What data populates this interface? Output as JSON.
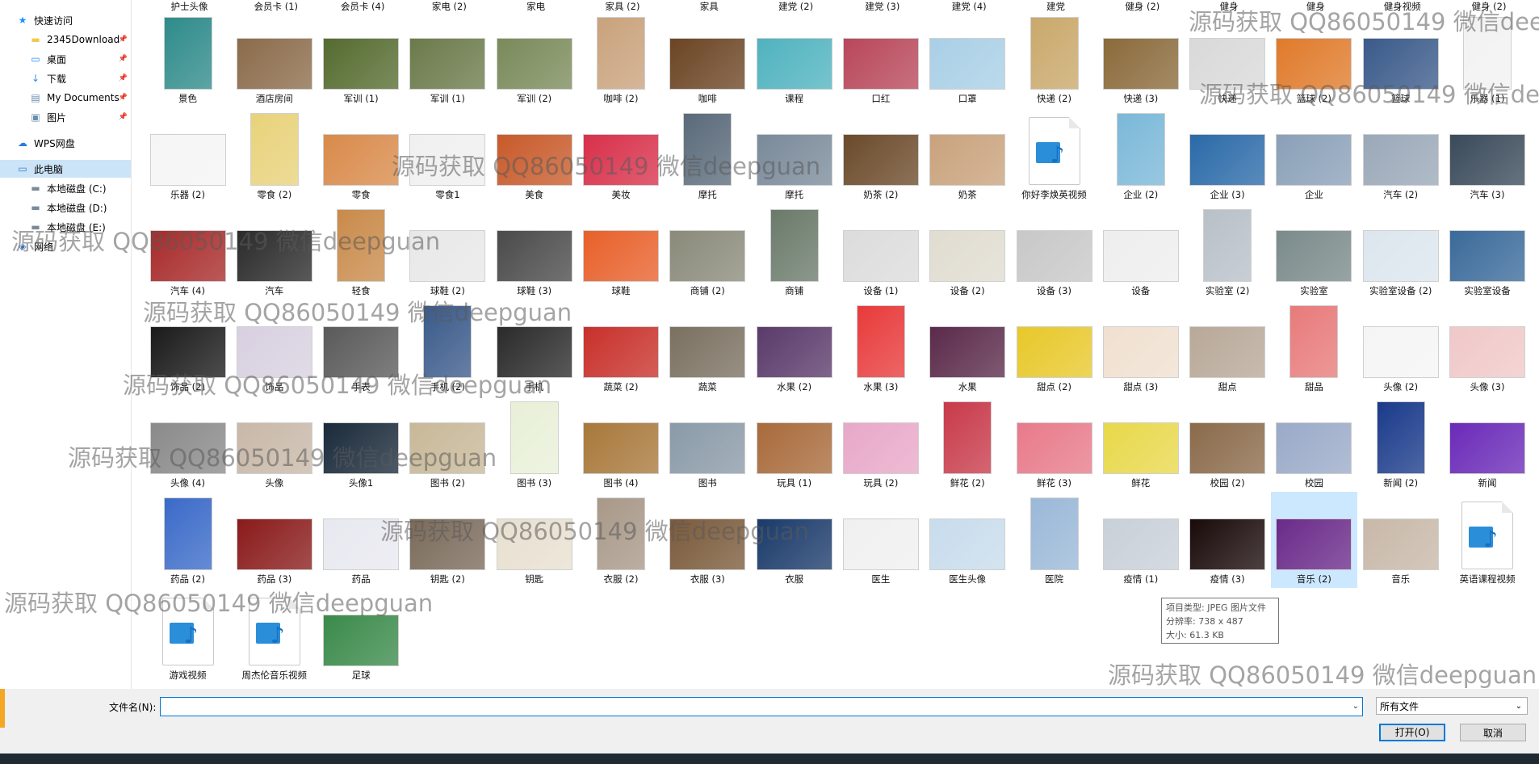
{
  "nav": [
    {
      "label": "快速访问",
      "icon": "star-icon",
      "pinned": false,
      "selected": false
    },
    {
      "label": "2345Download",
      "icon": "folder-icon",
      "pinned": true,
      "selected": false
    },
    {
      "label": "桌面",
      "icon": "desktop-icon",
      "pinned": true,
      "selected": false
    },
    {
      "label": "下载",
      "icon": "download-icon",
      "pinned": true,
      "selected": false
    },
    {
      "label": "My Documents",
      "icon": "documents-icon",
      "pinned": true,
      "selected": false
    },
    {
      "label": "图片",
      "icon": "pictures-icon",
      "pinned": true,
      "selected": false
    },
    {
      "label": "WPS网盘",
      "icon": "cloud-icon",
      "pinned": false,
      "selected": false
    },
    {
      "label": "此电脑",
      "icon": "computer-icon",
      "pinned": false,
      "selected": true
    },
    {
      "label": "本地磁盘 (C:)",
      "icon": "drive-icon",
      "pinned": false,
      "selected": false
    },
    {
      "label": "本地磁盘 (D:)",
      "icon": "drive-icon",
      "pinned": false,
      "selected": false
    },
    {
      "label": "本地磁盘 (E:)",
      "icon": "drive-icon",
      "pinned": false,
      "selected": false
    },
    {
      "label": "网络",
      "icon": "network-icon",
      "pinned": false,
      "selected": false
    }
  ],
  "top_row": [
    "护士头像",
    "会员卡 (1)",
    "会员卡 (4)",
    "家电 (2)",
    "家电",
    "家具 (2)",
    "家具",
    "建党 (2)",
    "建党 (3)",
    "建党 (4)",
    "建党",
    "健身 (2)",
    "健身",
    "健身",
    "健身视频",
    "健身 (2)"
  ],
  "rows": [
    [
      {
        "label": "景色",
        "color": "#2e8b8a"
      },
      {
        "label": "酒店房间",
        "color": "#8b6b4a"
      },
      {
        "label": "军训 (1)",
        "color": "#556b2f"
      },
      {
        "label": "军训 (1)",
        "color": "#6b7a4a"
      },
      {
        "label": "军训 (2)",
        "color": "#7a8a5a"
      },
      {
        "label": "咖啡 (2)",
        "color": "#c9a27c"
      },
      {
        "label": "咖啡",
        "color": "#6b4423"
      },
      {
        "label": "课程",
        "color": "#4fb3bf"
      },
      {
        "label": "口红",
        "color": "#b8475a"
      },
      {
        "label": "口罩",
        "color": "#a9cfe6"
      },
      {
        "label": "快递 (2)",
        "color": "#c9a86a"
      },
      {
        "label": "快递 (3)",
        "color": "#8a6a3a"
      },
      {
        "label": "快递",
        "color": "#d9d9d9"
      },
      {
        "label": "篮球 (2)",
        "color": "#e07a2a"
      },
      {
        "label": "篮球",
        "color": "#3a5a8a"
      },
      {
        "label": "乐器 (1)",
        "color": "#f2f2f2"
      }
    ],
    [
      {
        "label": "乐器 (2)",
        "color": "#f5f5f5"
      },
      {
        "label": "零食 (2)",
        "color": "#e8d27a"
      },
      {
        "label": "零食",
        "color": "#d98a4a"
      },
      {
        "label": "零食1",
        "color": "#f0f0f0"
      },
      {
        "label": "美食",
        "color": "#c85a2a"
      },
      {
        "label": "美妆",
        "color": "#d8304a"
      },
      {
        "label": "摩托",
        "color": "#5a6a7a"
      },
      {
        "label": "摩托",
        "color": "#7a8a9a"
      },
      {
        "label": "奶茶 (2)",
        "color": "#6b4a2a"
      },
      {
        "label": "奶茶",
        "color": "#c9a27c"
      },
      {
        "label": "你好李焕英视频",
        "color": "video"
      },
      {
        "label": "企业 (2)",
        "color": "#7ab8d8"
      },
      {
        "label": "企业 (3)",
        "color": "#2a6aa8"
      },
      {
        "label": "企业",
        "color": "#8aa0b8"
      },
      {
        "label": "汽车 (2)",
        "color": "#9aa8b8"
      },
      {
        "label": "汽车 (3)",
        "color": "#3a4a5a"
      }
    ],
    [
      {
        "label": "汽车 (4)",
        "color": "#a82a2a"
      },
      {
        "label": "汽车",
        "color": "#2a2a2a"
      },
      {
        "label": "轻食",
        "color": "#c98a4a"
      },
      {
        "label": "球鞋 (2)",
        "color": "#e8e8e8"
      },
      {
        "label": "球鞋 (3)",
        "color": "#4a4a4a"
      },
      {
        "label": "球鞋",
        "color": "#e8602a"
      },
      {
        "label": "商铺 (2)",
        "color": "#8a8a7a"
      },
      {
        "label": "商铺",
        "color": "#6a7a6a"
      },
      {
        "label": "设备 (1)",
        "color": "#dcdcdc"
      },
      {
        "label": "设备 (2)",
        "color": "#e0dcd0"
      },
      {
        "label": "设备 (3)",
        "color": "#c8c8c8"
      },
      {
        "label": "设备",
        "color": "#eeeeee"
      },
      {
        "label": "实验室 (2)",
        "color": "#b8c0c8"
      },
      {
        "label": "实验室",
        "color": "#7a8a8a"
      },
      {
        "label": "实验室设备 (2)",
        "color": "#dce6ee"
      },
      {
        "label": "实验室设备",
        "color": "#3a6a9a"
      }
    ],
    [
      {
        "label": "饰品 (2)",
        "color": "#1a1a1a"
      },
      {
        "label": "饰品",
        "color": "#d8d0e0"
      },
      {
        "label": "手表",
        "color": "#5a5a5a"
      },
      {
        "label": "手机 (2)",
        "color": "#3a5a8a"
      },
      {
        "label": "手机",
        "color": "#2a2a2a"
      },
      {
        "label": "蔬菜 (2)",
        "color": "#c8302a"
      },
      {
        "label": "蔬菜",
        "color": "#7a7060"
      },
      {
        "label": "水果 (2)",
        "color": "#5a3a6a"
      },
      {
        "label": "水果 (3)",
        "color": "#e83a3a"
      },
      {
        "label": "水果",
        "color": "#5a2a4a"
      },
      {
        "label": "甜点 (2)",
        "color": "#e8c82a"
      },
      {
        "label": "甜点 (3)",
        "color": "#f0e0d0"
      },
      {
        "label": "甜点",
        "color": "#b8a898"
      },
      {
        "label": "甜品",
        "color": "#e87a7a"
      },
      {
        "label": "头像 (2)",
        "color": "#f5f5f5"
      },
      {
        "label": "头像 (3)",
        "color": "#f0c8c8"
      }
    ],
    [
      {
        "label": "头像 (4)",
        "color": "#8a8a8a"
      },
      {
        "label": "头像",
        "color": "#c8b8a8"
      },
      {
        "label": "头像1",
        "color": "#1a2a3a"
      },
      {
        "label": "图书 (2)",
        "color": "#c8b898"
      },
      {
        "label": "图书 (3)",
        "color": "#e8f0d8"
      },
      {
        "label": "图书 (4)",
        "color": "#a8783a"
      },
      {
        "label": "图书",
        "color": "#8a9aa8"
      },
      {
        "label": "玩具 (1)",
        "color": "#a86a3a"
      },
      {
        "label": "玩具 (2)",
        "color": "#e8a8c8"
      },
      {
        "label": "鲜花 (2)",
        "color": "#c83a4a"
      },
      {
        "label": "鲜花 (3)",
        "color": "#e87a8a"
      },
      {
        "label": "鲜花",
        "color": "#e8d84a"
      },
      {
        "label": "校园 (2)",
        "color": "#8a6a4a"
      },
      {
        "label": "校园",
        "color": "#9aaac8"
      },
      {
        "label": "新闻 (2)",
        "color": "#1a3a8a"
      },
      {
        "label": "新闻",
        "color": "#6a2ab8"
      }
    ],
    [
      {
        "label": "药品 (2)",
        "color": "#3a6ac8"
      },
      {
        "label": "药品 (3)",
        "color": "#8a1a1a"
      },
      {
        "label": "药品",
        "color": "#e8e8f0"
      },
      {
        "label": "钥匙 (2)",
        "color": "#7a6a5a"
      },
      {
        "label": "钥匙",
        "color": "#e8e0d0"
      },
      {
        "label": "衣服 (2)",
        "color": "#a89888"
      },
      {
        "label": "衣服 (3)",
        "color": "#7a5a3a"
      },
      {
        "label": "衣服",
        "color": "#1a3a6a"
      },
      {
        "label": "医生",
        "color": "#f0f0f0"
      },
      {
        "label": "医生头像",
        "color": "#c8dcec"
      },
      {
        "label": "医院",
        "color": "#9ab8d8"
      },
      {
        "label": "疫情 (1)",
        "color": "#c8d0d8"
      },
      {
        "label": "疫情 (3)",
        "color": "#1a0a0a"
      },
      {
        "label": "音乐 (2)",
        "color": "#6a2a8a",
        "selected": true
      },
      {
        "label": "音乐",
        "color": "#c8b8a8"
      },
      {
        "label": "英语课程视频",
        "color": "video"
      }
    ],
    [
      {
        "label": "游戏视频",
        "color": "video"
      },
      {
        "label": "周杰伦音乐视频",
        "color": "video"
      },
      {
        "label": "足球",
        "color": "#3a8a4a"
      }
    ]
  ],
  "tooltip": [
    "项目类型: JPEG 图片文件",
    "分辨率: 738 x 487",
    "大小: 61.3 KB"
  ],
  "filename_label": "文件名(N):",
  "filename_value": "",
  "filetype": "所有文件",
  "open_label": "打开(O)",
  "cancel_label": "取消",
  "watermark": "源码获取 QQ86050149 微信deepguan"
}
